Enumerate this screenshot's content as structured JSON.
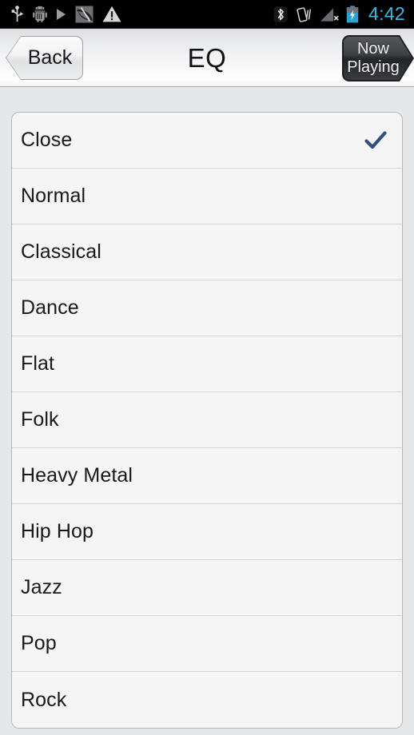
{
  "status_bar": {
    "icons_left": [
      "usb-icon",
      "android-debug-icon",
      "play-icon",
      "sync-disabled-icon",
      "warning-icon"
    ],
    "icons_right": [
      "bluetooth-icon",
      "vibrate-icon",
      "signal-no-service-icon",
      "battery-charging-icon"
    ],
    "clock": "4:42",
    "clock_color": "#3bb9e8",
    "background_color": "#000000"
  },
  "nav_bar": {
    "title": "EQ",
    "back_label": "Back",
    "now_playing_line1": "Now",
    "now_playing_line2": "Playing"
  },
  "eq_list": {
    "checkmark_color": "#2f4f83",
    "selected_index": 0,
    "items": [
      {
        "label": "Close",
        "selected": true
      },
      {
        "label": "Normal",
        "selected": false
      },
      {
        "label": "Classical",
        "selected": false
      },
      {
        "label": "Dance",
        "selected": false
      },
      {
        "label": "Flat",
        "selected": false
      },
      {
        "label": "Folk",
        "selected": false
      },
      {
        "label": "Heavy Metal",
        "selected": false
      },
      {
        "label": "Hip Hop",
        "selected": false
      },
      {
        "label": "Jazz",
        "selected": false
      },
      {
        "label": "Pop",
        "selected": false
      },
      {
        "label": "Rock",
        "selected": false
      }
    ]
  },
  "theme": {
    "page_background": "#e6e7e9",
    "card_background": "#f5f5f6",
    "separator": "#d2d3d5",
    "text": "#18191b"
  }
}
